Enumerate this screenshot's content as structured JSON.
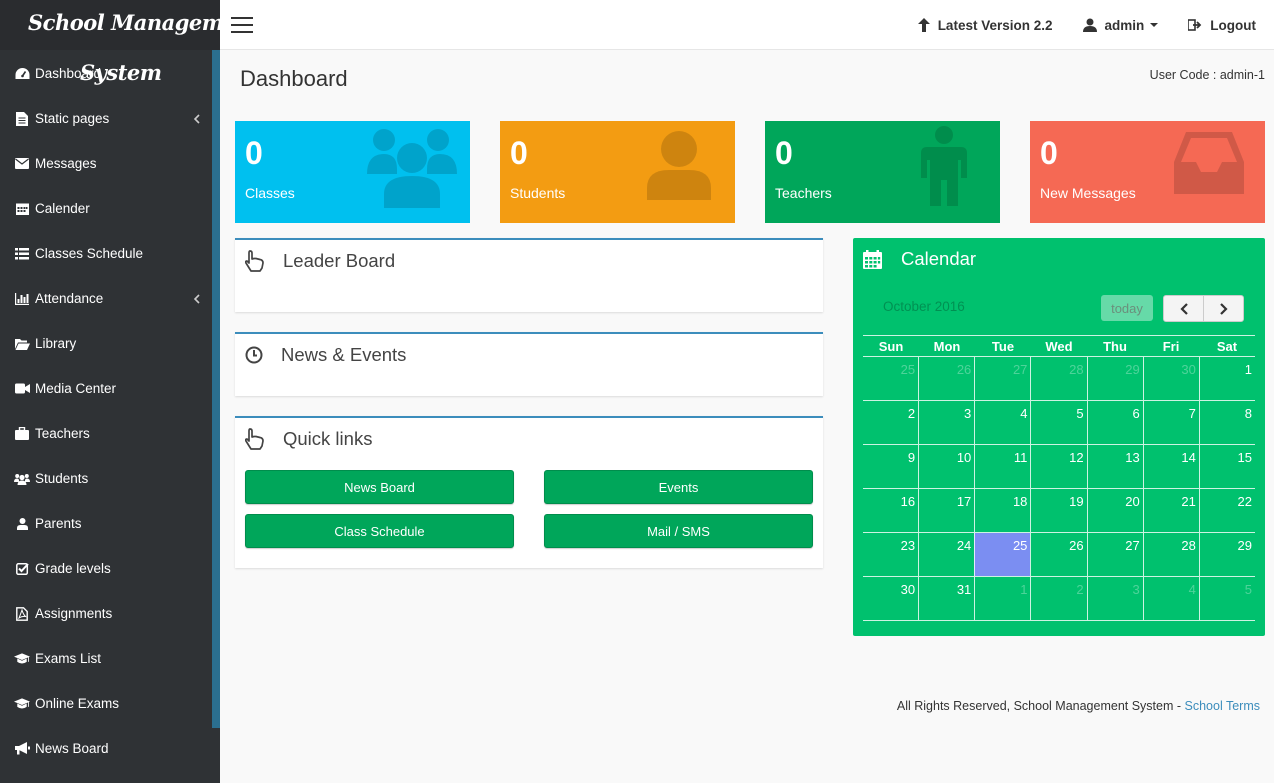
{
  "brand": {
    "line1": "School Management",
    "line2": "System"
  },
  "sidebar": {
    "items": [
      {
        "label": "Dashboard",
        "icon": "dashboard-icon"
      },
      {
        "label": "Static pages",
        "icon": "file-icon",
        "chevron": true
      },
      {
        "label": "Messages",
        "icon": "envelope-icon"
      },
      {
        "label": "Calender",
        "icon": "calendar-icon"
      },
      {
        "label": "Classes Schedule",
        "icon": "list-icon"
      },
      {
        "label": "Attendance",
        "icon": "bar-chart-icon",
        "chevron": true
      },
      {
        "label": "Library",
        "icon": "folder-open-icon"
      },
      {
        "label": "Media Center",
        "icon": "video-camera-icon"
      },
      {
        "label": "Teachers",
        "icon": "briefcase-icon"
      },
      {
        "label": "Students",
        "icon": "users-icon"
      },
      {
        "label": "Parents",
        "icon": "user-icon"
      },
      {
        "label": "Grade levels",
        "icon": "check-square-icon"
      },
      {
        "label": "Assignments",
        "icon": "file-pdf-icon"
      },
      {
        "label": "Exams List",
        "icon": "graduation-cap-icon"
      },
      {
        "label": "Online Exams",
        "icon": "graduation-cap-icon"
      },
      {
        "label": "News Board",
        "icon": "bullhorn-icon"
      }
    ]
  },
  "topbar": {
    "version_label": "Latest Version 2.2",
    "user_label": "admin",
    "logout_label": "Logout"
  },
  "page": {
    "title": "Dashboard",
    "user_code": "User Code : admin-1"
  },
  "stats": [
    {
      "value": "0",
      "label": "Classes",
      "color": "#00c0ef",
      "icon": "users-icon"
    },
    {
      "value": "0",
      "label": "Students",
      "color": "#f39c12",
      "icon": "user-icon"
    },
    {
      "value": "0",
      "label": "Teachers",
      "color": "#00a65a",
      "icon": "male-icon"
    },
    {
      "value": "0",
      "label": "New Messages",
      "color": "#f56954",
      "icon": "inbox-icon"
    }
  ],
  "panels": {
    "leaderboard": "Leader Board",
    "news": "News & Events",
    "quicklinks": "Quick links"
  },
  "quicklinks": [
    "News Board",
    "Events",
    "Class Schedule",
    "Mail / SMS"
  ],
  "calendar": {
    "title": "Calendar",
    "month": "October 2016",
    "today_label": "today",
    "weekdays": [
      "Sun",
      "Mon",
      "Tue",
      "Wed",
      "Thu",
      "Fri",
      "Sat"
    ],
    "weeks": [
      [
        [
          "25",
          1
        ],
        [
          "26",
          1
        ],
        [
          "27",
          1
        ],
        [
          "28",
          1
        ],
        [
          "29",
          1
        ],
        [
          "30",
          1
        ],
        [
          "1",
          0
        ]
      ],
      [
        [
          "2",
          0
        ],
        [
          "3",
          0
        ],
        [
          "4",
          0
        ],
        [
          "5",
          0
        ],
        [
          "6",
          0
        ],
        [
          "7",
          0
        ],
        [
          "8",
          0
        ]
      ],
      [
        [
          "9",
          0
        ],
        [
          "10",
          0
        ],
        [
          "11",
          0
        ],
        [
          "12",
          0
        ],
        [
          "13",
          0
        ],
        [
          "14",
          0
        ],
        [
          "15",
          0
        ]
      ],
      [
        [
          "16",
          0
        ],
        [
          "17",
          0
        ],
        [
          "18",
          0
        ],
        [
          "19",
          0
        ],
        [
          "20",
          0
        ],
        [
          "21",
          0
        ],
        [
          "22",
          0
        ]
      ],
      [
        [
          "23",
          0
        ],
        [
          "24",
          0
        ],
        [
          "25",
          2
        ],
        [
          "26",
          0
        ],
        [
          "27",
          0
        ],
        [
          "28",
          0
        ],
        [
          "29",
          0
        ]
      ],
      [
        [
          "30",
          0
        ],
        [
          "31",
          0
        ],
        [
          "1",
          1
        ],
        [
          "2",
          1
        ],
        [
          "3",
          1
        ],
        [
          "4",
          1
        ],
        [
          "5",
          1
        ]
      ]
    ]
  },
  "footer": {
    "text": "All Rights Reserved, School Management System - ",
    "link": "School Terms"
  }
}
